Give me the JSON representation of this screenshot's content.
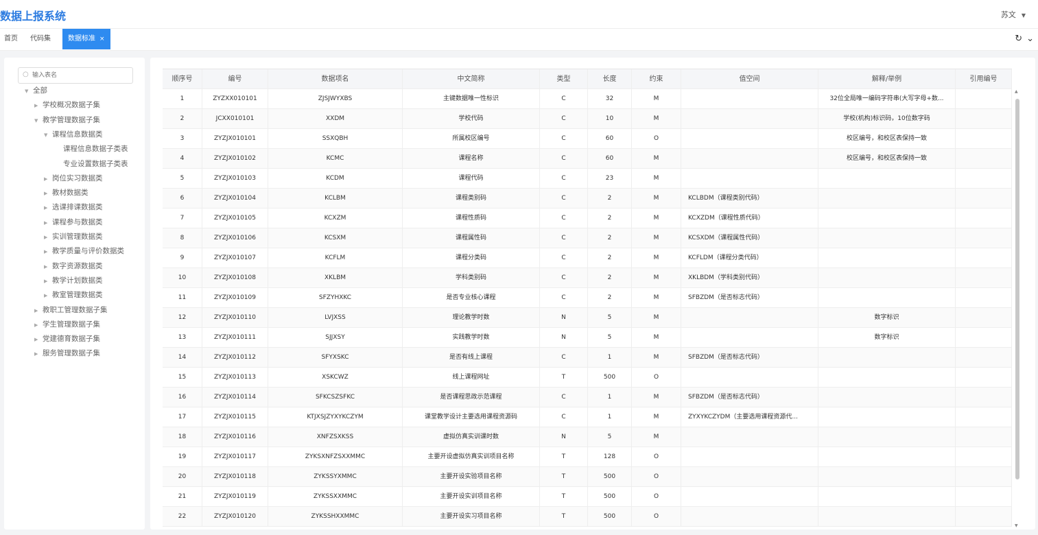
{
  "app": {
    "title": "数据上报系统",
    "user": "苏文",
    "caret": "▼"
  },
  "tabs": [
    {
      "label": "首页",
      "active": false
    },
    {
      "label": "代码集",
      "active": false
    },
    {
      "label": "数据标准",
      "active": true,
      "close": "×"
    }
  ],
  "tab_tools": {
    "refresh": "↻",
    "expand": "⌄"
  },
  "sidebar": {
    "search": {
      "placeholder": "输入表名",
      "icon": "○"
    },
    "tree": [
      {
        "label": "全部",
        "level": 0,
        "arrow": "▼"
      },
      {
        "label": "学校概况数据子集",
        "level": 1,
        "arrow": "▶"
      },
      {
        "label": "教学管理数据子集",
        "level": 1,
        "arrow": "▼"
      },
      {
        "label": "课程信息数据类",
        "level": 2,
        "arrow": "▼"
      },
      {
        "label": "课程信息数据子类表",
        "level": 3,
        "arrow": ""
      },
      {
        "label": "专业设置数据子类表",
        "level": 3,
        "arrow": ""
      },
      {
        "label": "岗位实习数据类",
        "level": 2,
        "arrow": "▶"
      },
      {
        "label": "教材数据类",
        "level": 2,
        "arrow": "▶"
      },
      {
        "label": "选课排课数据类",
        "level": 2,
        "arrow": "▶"
      },
      {
        "label": "课程参与数据类",
        "level": 2,
        "arrow": "▶"
      },
      {
        "label": "实训管理数据类",
        "level": 2,
        "arrow": "▶"
      },
      {
        "label": "教学质量与评价数据类",
        "level": 2,
        "arrow": "▶"
      },
      {
        "label": "数字资源数据类",
        "level": 2,
        "arrow": "▶"
      },
      {
        "label": "教学计划数据类",
        "level": 2,
        "arrow": "▶"
      },
      {
        "label": "教室管理数据类",
        "level": 2,
        "arrow": "▶"
      },
      {
        "label": "教职工管理数据子集",
        "level": 1,
        "arrow": "▶"
      },
      {
        "label": "学生管理数据子集",
        "level": 1,
        "arrow": "▶"
      },
      {
        "label": "党建德育数据子集",
        "level": 1,
        "arrow": "▶"
      },
      {
        "label": "服务管理数据子集",
        "level": 1,
        "arrow": "▶"
      }
    ]
  },
  "table": {
    "headers": [
      "顺序号",
      "编号",
      "数据项名",
      "中文简称",
      "类型",
      "长度",
      "约束",
      "值空间",
      "解释/举例",
      "引用编号"
    ],
    "rows": [
      [
        "1",
        "ZYZXX010101",
        "ZJSJWYXBS",
        "主键数据唯一性标识",
        "C",
        "32",
        "M",
        "",
        "32位全局唯一编码字符串(大写字母+数...",
        ""
      ],
      [
        "2",
        "JCXX010101",
        "XXDM",
        "学校代码",
        "C",
        "10",
        "M",
        "",
        "学校(机构)标识码，10位数字码",
        ""
      ],
      [
        "3",
        "ZYZJX010101",
        "SSXQBH",
        "所属校区编号",
        "C",
        "60",
        "O",
        "",
        "校区编号，和校区表保持一致",
        ""
      ],
      [
        "4",
        "ZYZJX010102",
        "KCMC",
        "课程名称",
        "C",
        "60",
        "M",
        "",
        "校区编号，和校区表保持一致",
        ""
      ],
      [
        "5",
        "ZYZJX010103",
        "KCDM",
        "课程代码",
        "C",
        "23",
        "M",
        "",
        "",
        ""
      ],
      [
        "6",
        "ZYZJX010104",
        "KCLBM",
        "课程类别码",
        "C",
        "2",
        "M",
        "KCLBDM（课程类别代码）",
        "",
        ""
      ],
      [
        "7",
        "ZYZJX010105",
        "KCXZM",
        "课程性质码",
        "C",
        "2",
        "M",
        "KCXZDM（课程性质代码）",
        "",
        ""
      ],
      [
        "8",
        "ZYZJX010106",
        "KCSXM",
        "课程属性码",
        "C",
        "2",
        "M",
        "KCSXDM（课程属性代码）",
        "",
        ""
      ],
      [
        "9",
        "ZYZJX010107",
        "KCFLM",
        "课程分类码",
        "C",
        "2",
        "M",
        "KCFLDM（课程分类代码）",
        "",
        ""
      ],
      [
        "10",
        "ZYZJX010108",
        "XKLBM",
        "学科类别码",
        "C",
        "2",
        "M",
        "XKLBDM（学科类别代码）",
        "",
        ""
      ],
      [
        "11",
        "ZYZJX010109",
        "SFZYHXKC",
        "是否专业核心课程",
        "C",
        "2",
        "M",
        "SFBZDM（是否标志代码）",
        "",
        ""
      ],
      [
        "12",
        "ZYZJX010110",
        "LVJXSS",
        "理论教学时数",
        "N",
        "5",
        "M",
        "",
        "数字标识",
        ""
      ],
      [
        "13",
        "ZYZJX010111",
        "SJJXSY",
        "实践教学时数",
        "N",
        "5",
        "M",
        "",
        "数字标识",
        ""
      ],
      [
        "14",
        "ZYZJX010112",
        "SFYXSKC",
        "是否有线上课程",
        "C",
        "1",
        "M",
        "SFBZDM（是否标志代码）",
        "",
        ""
      ],
      [
        "15",
        "ZYZJX010113",
        "XSKCWZ",
        "线上课程网址",
        "T",
        "500",
        "O",
        "",
        "",
        ""
      ],
      [
        "16",
        "ZYZJX010114",
        "SFKCSZSFKC",
        "是否课程思政示范课程",
        "C",
        "1",
        "M",
        "SFBZDM（是否标志代码）",
        "",
        ""
      ],
      [
        "17",
        "ZYZJX010115",
        "KTJXSJZYXYKCZYM",
        "课堂教学设计主要选用课程资源码",
        "C",
        "1",
        "M",
        "ZYXYKCZYDM（主要选用课程资源代...",
        "",
        ""
      ],
      [
        "18",
        "ZYZJX010116",
        "XNFZSXKSS",
        "虚拟仿真实训课时数",
        "N",
        "5",
        "M",
        "",
        "",
        ""
      ],
      [
        "19",
        "ZYZJX010117",
        "ZYKSXNFZSXXMMC",
        "主要开设虚拟仿真实训项目名称",
        "T",
        "128",
        "O",
        "",
        "",
        ""
      ],
      [
        "20",
        "ZYZJX010118",
        "ZYKSSYXMMC",
        "主要开设实验项目名称",
        "T",
        "500",
        "O",
        "",
        "",
        ""
      ],
      [
        "21",
        "ZYZJX010119",
        "ZYKSSXXMMC",
        "主要开设实训项目名称",
        "T",
        "500",
        "O",
        "",
        "",
        ""
      ],
      [
        "22",
        "ZYZJX010120",
        "ZYKSSHXXMMC",
        "主要开设实习项目名称",
        "T",
        "500",
        "O",
        "",
        "",
        ""
      ]
    ]
  },
  "scrollbar": {
    "up": "▲",
    "down": "▼"
  }
}
